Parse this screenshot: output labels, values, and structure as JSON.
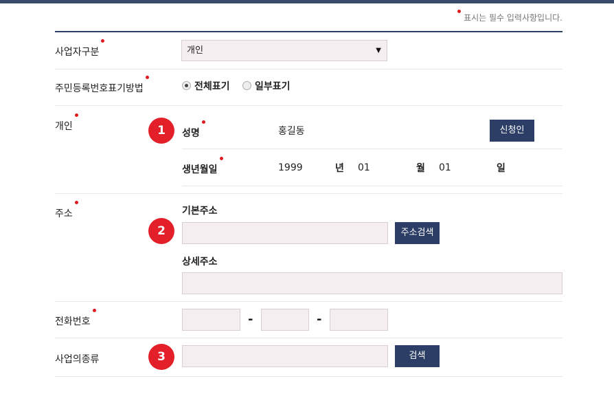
{
  "notice": "표시는 필수 입력사항입니다.",
  "business_type": {
    "label": "사업자구분",
    "selected": "개인",
    "arrow": "▼"
  },
  "ssn_display": {
    "label": "주민등록번호표기방법",
    "options": [
      "전체표기",
      "일부표기"
    ],
    "selected_index": 0
  },
  "individual": {
    "label": "개인",
    "badge": "1",
    "name_label": "성명",
    "name_value": "홍길동",
    "applicant_button": "신청인",
    "birth_label": "생년월일",
    "year": "1999",
    "year_unit": "년",
    "month": "01",
    "month_unit": "월",
    "day": "01",
    "day_unit": "일"
  },
  "address": {
    "label": "주소",
    "badge": "2",
    "basic_label": "기본주소",
    "search_button": "주소검색",
    "detail_label": "상세주소"
  },
  "phone": {
    "label": "전화번호",
    "separator": "-"
  },
  "business_kind": {
    "label": "사업의종류",
    "badge": "3",
    "search_button": "검색"
  },
  "colors": {
    "navy": "#2c3e66",
    "required_red": "#e0191f",
    "badge_red": "#e3202a",
    "input_bg": "#f4eef0"
  }
}
